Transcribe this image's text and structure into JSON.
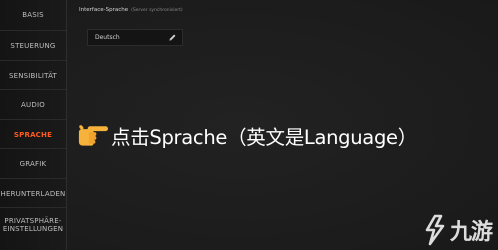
{
  "sidebar": {
    "items": [
      {
        "label": "BASIS",
        "active": false
      },
      {
        "label": "STEUERUNG",
        "active": false
      },
      {
        "label": "SENSIBILITÄT",
        "active": false
      },
      {
        "label": "AUDIO",
        "active": false
      },
      {
        "label": "SPRACHE",
        "active": true
      },
      {
        "label": "GRAFIK",
        "active": false
      },
      {
        "label": "HERUNTERLADEN",
        "active": false
      },
      {
        "label": "PRIVATSPHÄRE-\nEINSTELLUNGEN",
        "active": false
      }
    ]
  },
  "main": {
    "section_title": "Interface-Sprache",
    "section_subtitle": "(Server synchronisiert)",
    "language_field": {
      "value": "Deutsch",
      "icon": "pencil-icon"
    }
  },
  "overlay": {
    "pointer_icon": "pointing-hand-emoji",
    "caption": "点击Sprache（英文是Language）"
  },
  "watermark": {
    "text": "九游"
  },
  "colors": {
    "active_accent": "#ff5a1f",
    "background": "#1e1e1e",
    "sidebar_text": "#bfbfbf"
  }
}
